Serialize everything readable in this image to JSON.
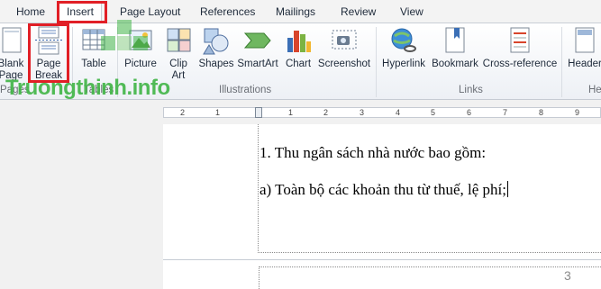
{
  "tabs": [
    {
      "label": "Home",
      "active": false
    },
    {
      "label": "Insert",
      "active": true
    },
    {
      "label": "Page Layout",
      "active": false
    },
    {
      "label": "References",
      "active": false
    },
    {
      "label": "Mailings",
      "active": false
    },
    {
      "label": "Review",
      "active": false
    },
    {
      "label": "View",
      "active": false
    }
  ],
  "ribbon": {
    "blank_page": {
      "line1": "Blank",
      "line2": "Page"
    },
    "page_break": {
      "line1": "Page",
      "line2": "Break"
    },
    "table": {
      "line1": "Table"
    },
    "picture": {
      "line1": "Picture"
    },
    "clip_art": {
      "line1": "Clip",
      "line2": "Art"
    },
    "shapes": {
      "line1": "Shapes"
    },
    "smartart": {
      "line1": "SmartArt"
    },
    "chart": {
      "line1": "Chart"
    },
    "screenshot": {
      "line1": "Screenshot"
    },
    "hyperlink": {
      "line1": "Hyperlink"
    },
    "bookmark": {
      "line1": "Bookmark"
    },
    "cross_reference": {
      "line1": "Cross-reference"
    },
    "header": {
      "line1": "Header"
    },
    "groups": {
      "pages": "Pages",
      "tables": "Tables",
      "illustrations": "Illustrations",
      "links": "Links",
      "header_footer": "He"
    }
  },
  "ruler": {
    "numbers": [
      "2",
      "1",
      "1",
      "2",
      "3",
      "4",
      "5",
      "6",
      "7",
      "8",
      "9"
    ]
  },
  "document": {
    "line1": "1. Thu ngân sách nhà nước bao gồm:",
    "line2": "a) Toàn bộ các khoản thu từ thuế, lệ phí;",
    "page_number": "3"
  },
  "watermark": {
    "text": "Truongthinh.info"
  },
  "colors": {
    "highlight_red": "#e11f26",
    "watermark_green": "#43b649"
  }
}
